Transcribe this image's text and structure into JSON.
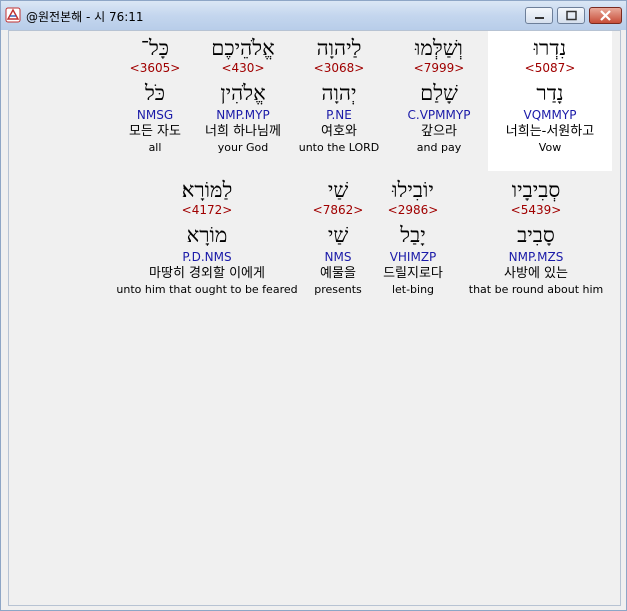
{
  "window": {
    "title": "@원전본해 - 시 76:11",
    "app_icon": "bible-app-icon"
  },
  "rows": [
    {
      "words": [
        {
          "hebrew": "נִדְרוּ",
          "strong": "<5087>",
          "lemma": "נָדַר",
          "morph": "VQMMYP",
          "korean": "너희는-서원하고",
          "english": "Vow"
        },
        {
          "hebrew": "וְשַׁלְּמוּ",
          "strong": "<7999>",
          "lemma": "שָׁלַם",
          "morph": "C.VPMMYP",
          "korean": "갚으라",
          "english": "and pay"
        },
        {
          "hebrew": "לַיהוָה",
          "strong": "<3068>",
          "lemma": "יְהוָה",
          "morph": "P.NE",
          "korean": "여호와",
          "english": "unto the LORD"
        },
        {
          "hebrew": "אֱלֹהֵיכֶם",
          "strong": "<430>",
          "lemma": "אֱלֹהִין",
          "morph": "NMP.MYP",
          "korean": "너희 하나님께",
          "english": "your God"
        },
        {
          "hebrew": "כָּל־",
          "strong": "<3605>",
          "lemma": "כֹּל",
          "morph": "NMSG",
          "korean": "모든 자도",
          "english": "all"
        }
      ]
    },
    {
      "words": [
        {
          "hebrew": "סְבִיבָיו",
          "strong": "<5439>",
          "lemma": "סָבִיב",
          "morph": "NMP.MZS",
          "korean": "사방에 있는",
          "english": "that be round about him"
        },
        {
          "hebrew": "יוֹבִילוּ",
          "strong": "<2986>",
          "lemma": "יָבַל",
          "morph": "VHIMZP",
          "korean": "드릴지로다",
          "english": "let-bing"
        },
        {
          "hebrew": "שַׁי",
          "strong": "<7862>",
          "lemma": "שַׁי",
          "morph": "NMS",
          "korean": "예물을",
          "english": "presents"
        },
        {
          "hebrew": "לַמּוֹרָא׃",
          "strong": "<4172>",
          "lemma": "מוֹרָא",
          "morph": "P.D.NMS",
          "korean": "마땅히 경외할 이에게",
          "english": "unto him that ought to be feared"
        }
      ]
    }
  ]
}
